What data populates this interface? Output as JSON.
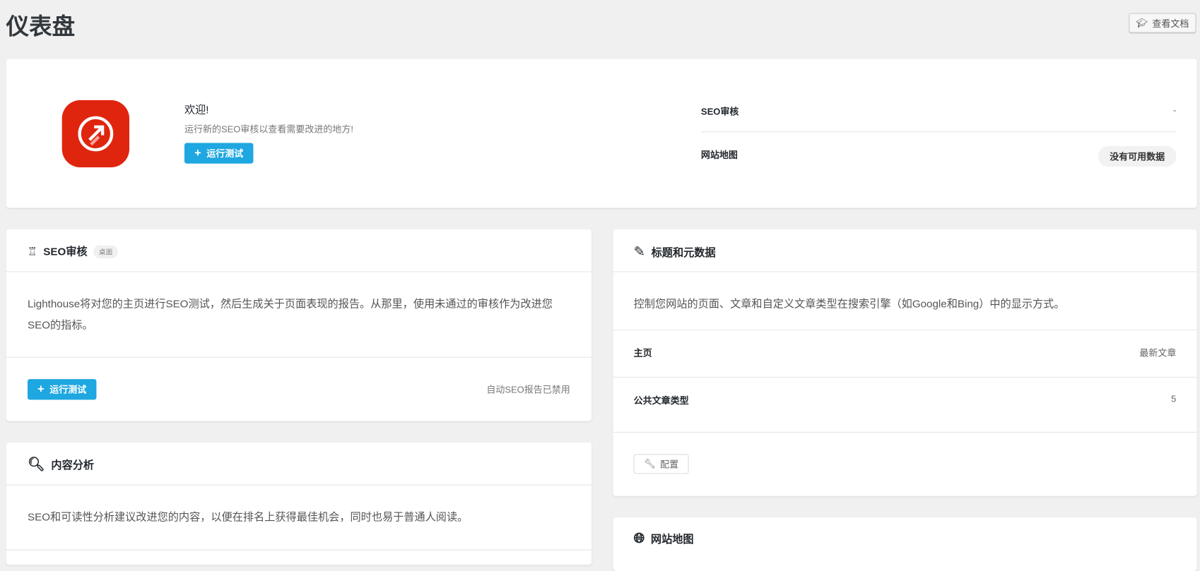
{
  "page_title": "仪表盘",
  "docs_button": "查看文档",
  "welcome": {
    "title": "欢迎!",
    "subtitle": "运行新的SEO审核以查看需要改进的地方!",
    "run_button": "运行测试",
    "stats": [
      {
        "label": "SEO审核",
        "value": "-"
      },
      {
        "label": "网站地图",
        "value": "没有可用数据"
      }
    ]
  },
  "seo_audit": {
    "title": "SEO审核",
    "badge": "桌面",
    "description": "Lighthouse将对您的主页进行SEO测试，然后生成关于页面表现的报告。从那里，使用未通过的审核作为改进您SEO的指标。",
    "run_button": "运行测试",
    "status": "自动SEO报告已禁用"
  },
  "content_analysis": {
    "title": "内容分析",
    "description": "SEO和可读性分析建议改进您的内容，以便在排名上获得最佳机会，同时也易于普通人阅读。"
  },
  "titles_meta": {
    "title": "标题和元数据",
    "description": "控制您网站的页面、文章和自定义文章类型在搜索引擎（如Google和Bing）中的显示方式。",
    "rows": [
      {
        "label": "主页",
        "value": "最新文章"
      },
      {
        "label": "公共文章类型",
        "value": "5"
      }
    ],
    "configure_button": "配置"
  },
  "sitemap": {
    "title": "网站地图"
  },
  "colors": {
    "accent": "#1ea7e1",
    "logo": "#e0250f"
  }
}
